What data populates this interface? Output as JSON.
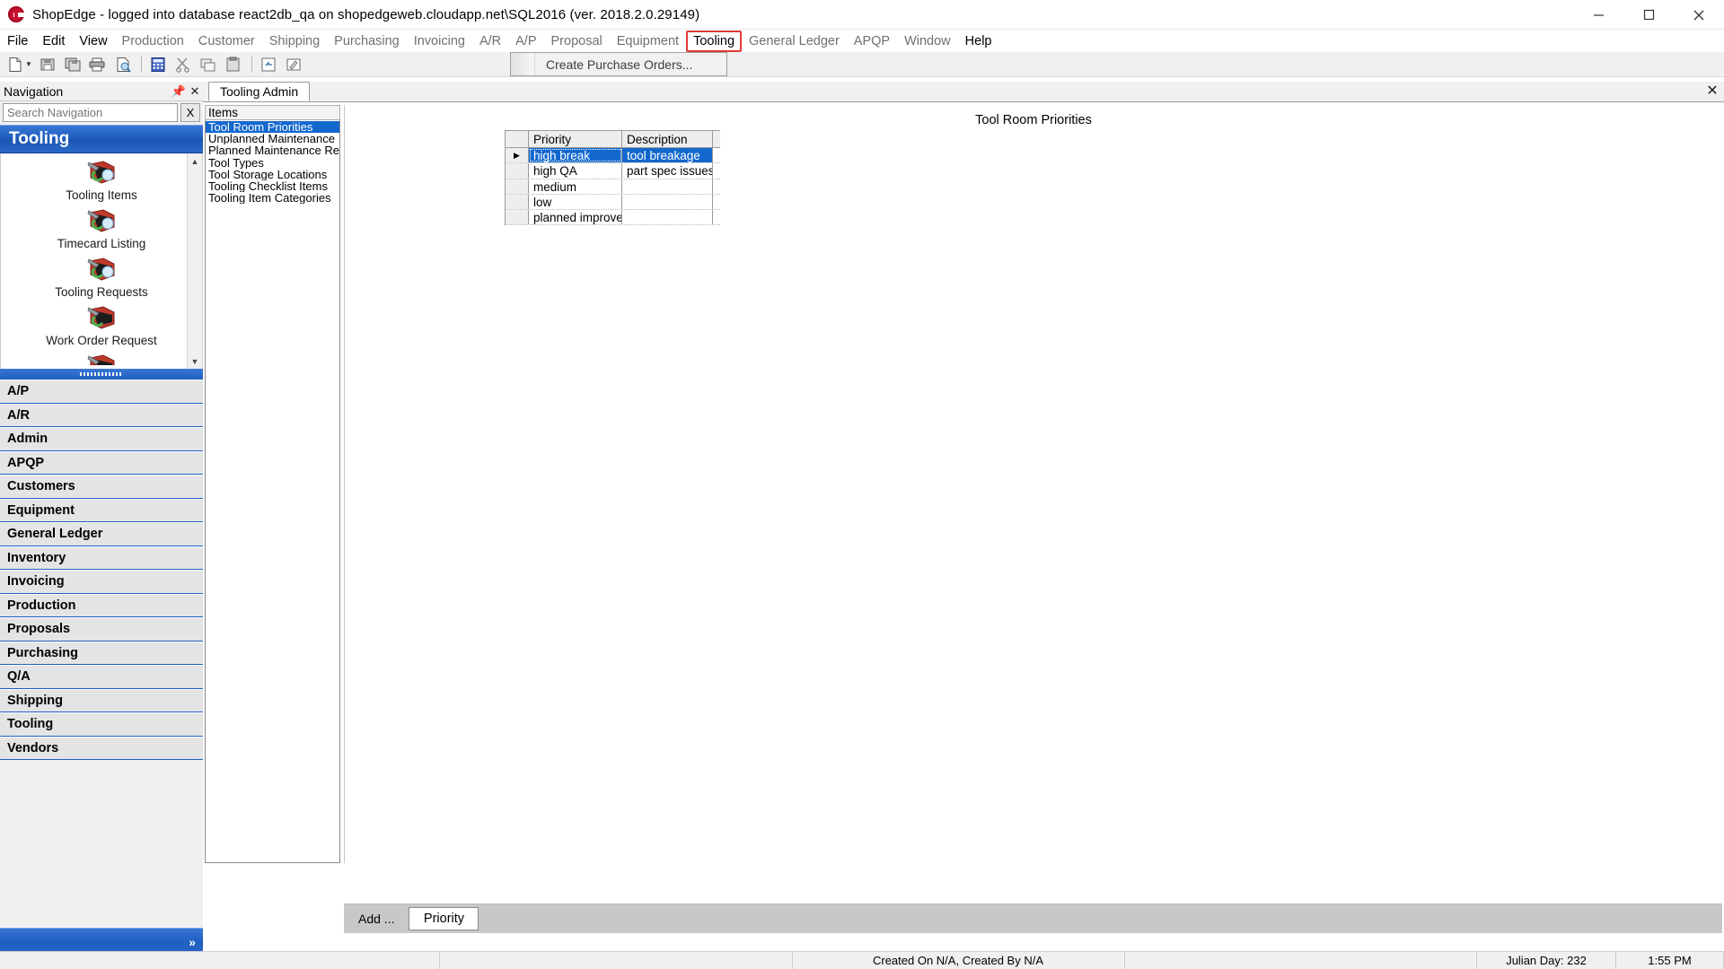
{
  "window": {
    "title": "ShopEdge -  logged into database react2db_qa on shopedgeweb.cloudapp.net\\SQL2016 (ver. 2018.2.0.29149)",
    "app_icon": "shopedge-logo-icon",
    "minimize_label": "─",
    "maximize_label": "❐",
    "close_label": "✕"
  },
  "menubar": {
    "items": [
      {
        "label": "File",
        "enabled": true,
        "active": false
      },
      {
        "label": "Edit",
        "enabled": true,
        "active": false
      },
      {
        "label": "View",
        "enabled": true,
        "active": false
      },
      {
        "label": "Production",
        "enabled": false,
        "active": false
      },
      {
        "label": "Customer",
        "enabled": false,
        "active": false
      },
      {
        "label": "Shipping",
        "enabled": false,
        "active": false
      },
      {
        "label": "Purchasing",
        "enabled": false,
        "active": false
      },
      {
        "label": "Invoicing",
        "enabled": false,
        "active": false
      },
      {
        "label": "A/R",
        "enabled": false,
        "active": false
      },
      {
        "label": "A/P",
        "enabled": false,
        "active": false
      },
      {
        "label": "Proposal",
        "enabled": false,
        "active": false
      },
      {
        "label": "Equipment",
        "enabled": false,
        "active": false
      },
      {
        "label": "Tooling",
        "enabled": true,
        "active": true
      },
      {
        "label": "General Ledger",
        "enabled": false,
        "active": false
      },
      {
        "label": "APQP",
        "enabled": false,
        "active": false
      },
      {
        "label": "Window",
        "enabled": false,
        "active": false
      },
      {
        "label": "Help",
        "enabled": true,
        "active": false
      }
    ]
  },
  "dropdown": {
    "open": true,
    "parent": "Tooling",
    "items": [
      {
        "label": "Create Purchase Orders...",
        "enabled": false
      }
    ]
  },
  "toolbar": {
    "buttons": [
      {
        "name": "new-document-icon"
      },
      {
        "name": "new-dropdown-caret-icon"
      },
      {
        "name": "save-icon"
      },
      {
        "name": "save-all-icon"
      },
      {
        "name": "print-icon"
      },
      {
        "name": "print-preview-icon"
      },
      {
        "name": "calculator-icon"
      },
      {
        "name": "cut-icon"
      },
      {
        "name": "copy-icon"
      },
      {
        "name": "paste-icon"
      },
      {
        "name": "undo-icon"
      },
      {
        "name": "notes-icon"
      }
    ]
  },
  "navigation": {
    "header_title": "Navigation",
    "pin_icon": "pin-icon",
    "close_icon": "close-icon",
    "search": {
      "value": "",
      "placeholder": "Search Navigation",
      "clear_label": "X"
    },
    "active_group": "Tooling",
    "shortcuts": [
      {
        "label": "Tooling Items",
        "icon": "tooling-item-icon"
      },
      {
        "label": "Timecard Listing",
        "icon": "tooling-item-icon"
      },
      {
        "label": "Tooling Requests",
        "icon": "tooling-item-icon"
      },
      {
        "label": "Work Order Request",
        "icon": "tooling-item-icon"
      }
    ],
    "scroll_up": "▲",
    "scroll_down": "▼",
    "categories": [
      "A/P",
      "A/R",
      "Admin",
      "APQP",
      "Customers",
      "Equipment",
      "General Ledger",
      "Inventory",
      "Invoicing",
      "Production",
      "Proposals",
      "Purchasing",
      "Q/A",
      "Shipping",
      "Tooling",
      "Vendors"
    ],
    "expand_label": "»"
  },
  "document": {
    "tabs": [
      {
        "label": "Tooling Admin",
        "active": true
      }
    ],
    "close_tab_label": "✕"
  },
  "items_pane": {
    "header": "Items",
    "items": [
      {
        "label": "Tool Room Priorities",
        "selected": true
      },
      {
        "label": "Unplanned Maintenance",
        "selected": false
      },
      {
        "label": "Planned Maintenance Re",
        "selected": false
      },
      {
        "label": "Tool Types",
        "selected": false
      },
      {
        "label": "Tool Storage Locations",
        "selected": false
      },
      {
        "label": "Tooling Checklist Items",
        "selected": false
      },
      {
        "label": "Tooling Item Categories",
        "selected": false
      }
    ]
  },
  "content": {
    "title": "Tool Room Priorities",
    "grid": {
      "columns": [
        "Priority",
        "Description"
      ],
      "rows": [
        {
          "marker": true,
          "selected": true,
          "priority": "high break",
          "description": "tool breakage"
        },
        {
          "marker": false,
          "selected": false,
          "priority": "high QA",
          "description": "part spec issues"
        },
        {
          "marker": false,
          "selected": false,
          "priority": "medium",
          "description": ""
        },
        {
          "marker": false,
          "selected": false,
          "priority": "low",
          "description": ""
        },
        {
          "marker": false,
          "selected": false,
          "priority": "planned improve...",
          "description": ""
        }
      ]
    },
    "action_bar": {
      "add_label": "Add ...",
      "tab_label": "Priority"
    }
  },
  "statusbar": {
    "created_info": "Created On N/A, Created By N/A",
    "julian_day": "Julian Day: 232",
    "time": "1:55 PM"
  },
  "colors": {
    "accent_blue": "#1e5fc0",
    "selection_blue": "#1368ce",
    "menu_highlight_red": "#e03a3a",
    "panel_gray": "#f0f0f0",
    "action_bar_gray": "#c8c8c8"
  }
}
